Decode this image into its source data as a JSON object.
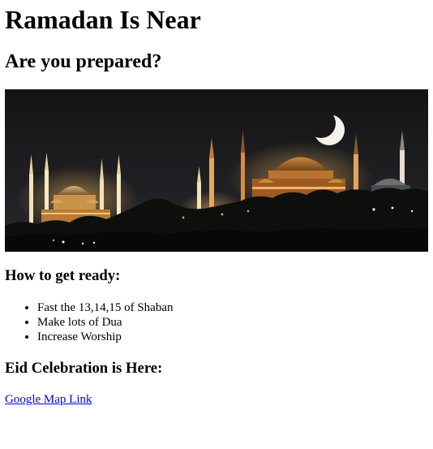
{
  "page": {
    "title": "Ramadan Is Near",
    "subtitle": "Are you prepared?"
  },
  "banner": {
    "icon": "mosque-night-photo"
  },
  "preparation": {
    "heading": "How to get ready:",
    "items": [
      "Fast the 13,14,15 of Shaban",
      "Make lots of Dua",
      "Increase Worship"
    ]
  },
  "eid": {
    "heading": "Eid Celebration is Here:",
    "link_label": "Google Map Link"
  },
  "colors": {
    "link": "#0000ee",
    "text": "#000000"
  }
}
